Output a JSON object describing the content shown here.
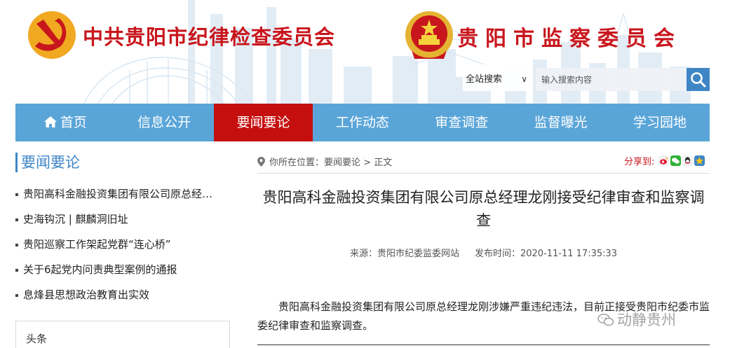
{
  "header": {
    "party_name": "中共贵阳市纪律检查委员会",
    "commission_name": "贵阳市监察委员会"
  },
  "search": {
    "scope_label": "全站搜索",
    "placeholder": "输入搜索内容"
  },
  "nav": {
    "items": [
      {
        "label": "首页"
      },
      {
        "label": "信息公开"
      },
      {
        "label": "要闻要论"
      },
      {
        "label": "工作动态"
      },
      {
        "label": "审查调查"
      },
      {
        "label": "监督曝光"
      },
      {
        "label": "学习园地"
      }
    ],
    "active": "要闻要论"
  },
  "sidebar": {
    "title": "要闻要论",
    "items": [
      {
        "label": "贵阳高科金融投资集团有限公司原总经…"
      },
      {
        "label": "史海钩沉 | 麒麟洞旧址"
      },
      {
        "label": "贵阳巡察工作架起党群“连心桥”"
      },
      {
        "label": "关于6起党内问责典型案例的通报"
      },
      {
        "label": "息烽县思想政治教育出实效"
      }
    ],
    "headline_title": "头条"
  },
  "breadcrumb": {
    "prefix": "你所在位置：",
    "section": "要闻要论",
    "separator": " > ",
    "current": "正文"
  },
  "share": {
    "label": "分享到:"
  },
  "article": {
    "title": "贵阳高科金融投资集团有限公司原总经理龙刚接受纪律审查和监察调查",
    "source": "来源：贵阳市纪委监委网站",
    "published": "发布时间：2020-11-11 17:35:33",
    "body": "贵阳高科金融投资集团有限公司原总经理龙刚涉嫌严重违纪违法，目前正接受贵阳市纪委市监委纪律审查和监察调查。"
  },
  "watermark": {
    "text": "动静贵州"
  },
  "colors": {
    "brand_red": "#c8161d",
    "nav_blue": "#5aa5d8",
    "active_red": "#c50f0f",
    "accent_blue": "#3f86c6"
  }
}
